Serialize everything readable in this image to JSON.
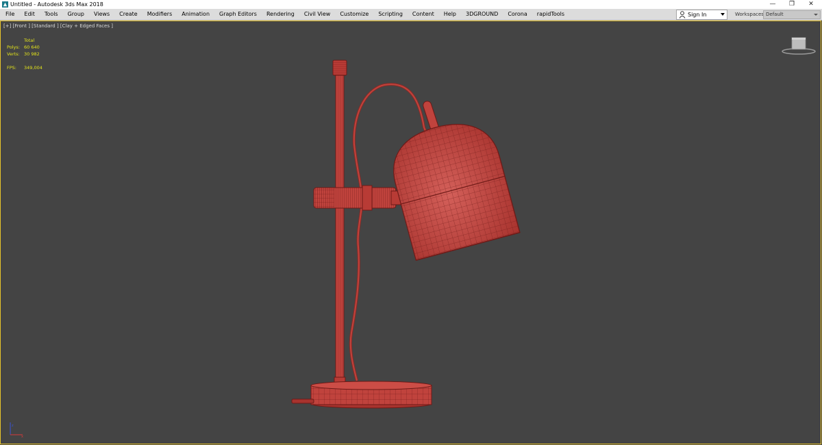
{
  "window": {
    "title": "Untitled - Autodesk 3ds Max 2018",
    "icons": [
      "app-icon",
      "minimize-icon",
      "restore-icon",
      "close-icon"
    ],
    "buttons": {
      "minimize": "—",
      "restore": "❐",
      "close": "✕"
    }
  },
  "menu": {
    "items": [
      "File",
      "Edit",
      "Tools",
      "Group",
      "Views",
      "Create",
      "Modifiers",
      "Animation",
      "Graph Editors",
      "Rendering",
      "Civil View",
      "Customize",
      "Scripting",
      "Content",
      "Help",
      "3DGROUND",
      "Corona",
      "rapidTools"
    ]
  },
  "account": {
    "signin_label": "Sign In",
    "workspaces_label": "Workspaces:",
    "workspace_value": "Default"
  },
  "viewport": {
    "label": "[+] [Front ] [Standard ] [Clay + Edged Faces ]",
    "border_color": "#e9c52b",
    "background": "#444444"
  },
  "stats": {
    "header": "Total",
    "rows": [
      {
        "key": "Polys:",
        "value": "60 640"
      },
      {
        "key": "Verts:",
        "value": "30 982"
      }
    ],
    "fps_key": "FPS:",
    "fps_value": "349,004",
    "color": "#e4e41a"
  },
  "scene": {
    "object": "desk-lamp-wireframe",
    "mesh_color": "#c0433d",
    "wire_color": "#6e1a17"
  }
}
